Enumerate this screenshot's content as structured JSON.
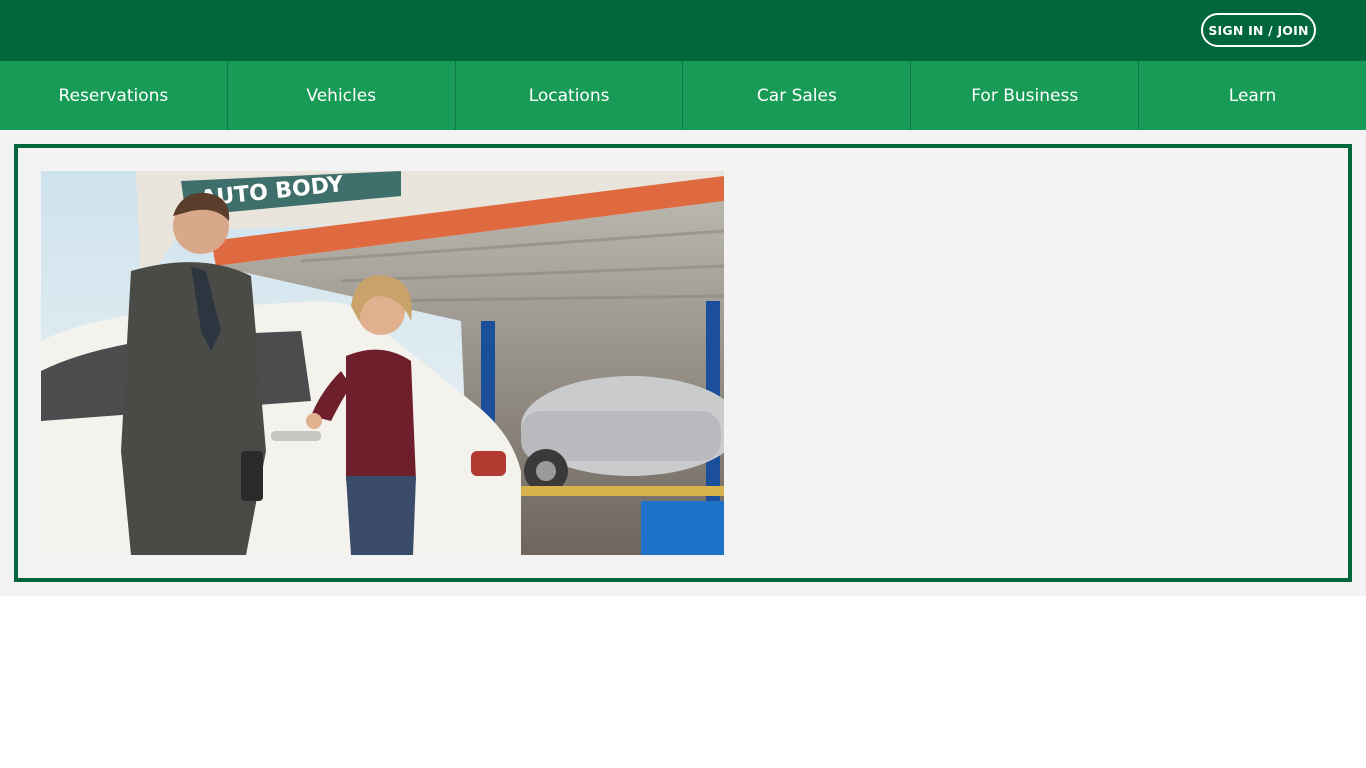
{
  "header": {
    "signin_label": "SIGN IN / JOIN"
  },
  "nav": {
    "items": [
      {
        "label": "Reservations"
      },
      {
        "label": "Vehicles"
      },
      {
        "label": "Locations"
      },
      {
        "label": "Car Sales"
      },
      {
        "label": "For Business"
      },
      {
        "label": "Learn"
      }
    ]
  },
  "hero": {
    "sign_text": "AUTO BODY"
  },
  "colors": {
    "brand_dark": "#00663b",
    "brand_green": "#189b56",
    "background": "#f3f3f3"
  }
}
